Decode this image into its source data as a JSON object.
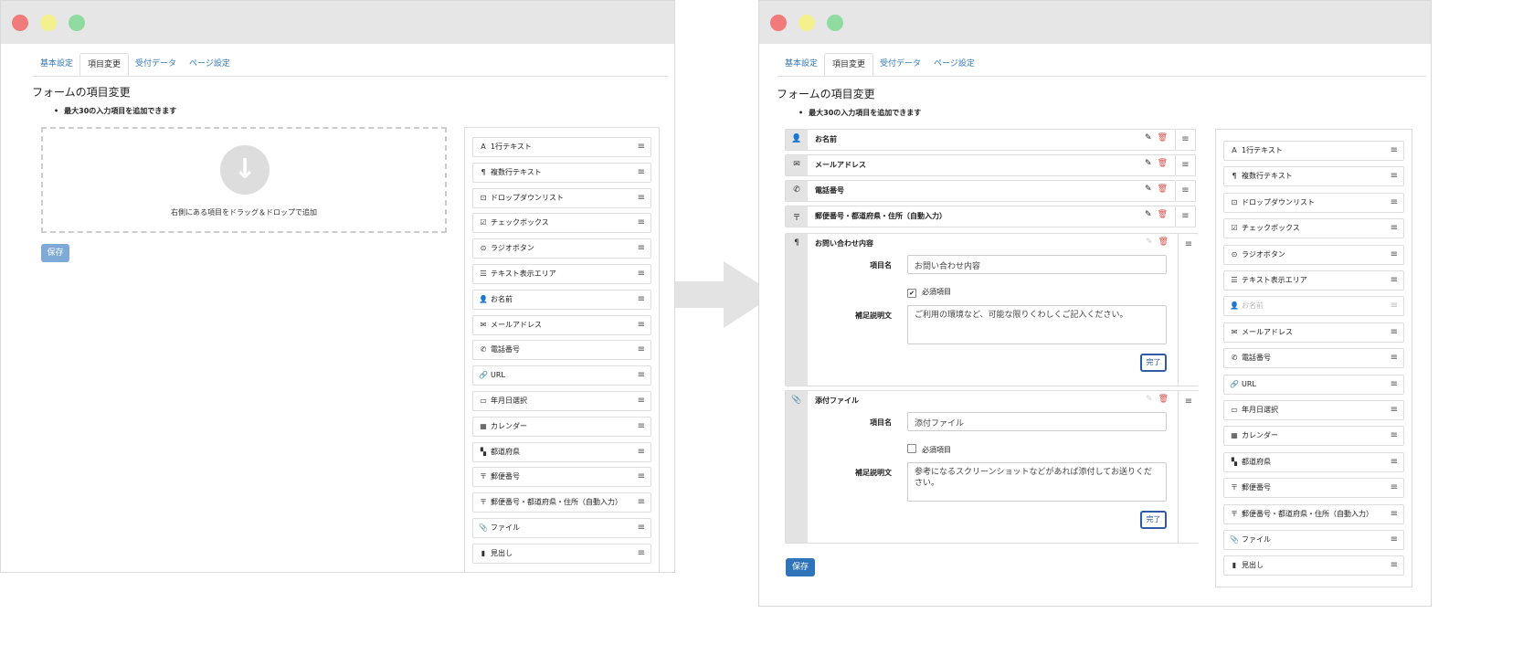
{
  "colors": {
    "tab_link": "#337ab7",
    "save_disabled": "#7fa9d6",
    "save_active": "#2f74b9",
    "delete": "#d9534f",
    "done_border": "#2e5aa8",
    "arrow": "#e3e3e3",
    "dot_red": "#f07b7a",
    "dot_yellow": "#f4f08d",
    "dot_green": "#8fdba0"
  },
  "tabs": [
    "基本設定",
    "項目変更",
    "受付データ",
    "ページ設定"
  ],
  "heading": "フォームの項目変更",
  "note": "最大30の入力項目を追加できます",
  "save_label": "保存",
  "drop_text": "右側にある項目をドラッグ＆ドロップで追加",
  "palette": [
    {
      "icon": "A",
      "label": "1行テキスト",
      "name": "single-line-text"
    },
    {
      "icon": "¶",
      "label": "複数行テキスト",
      "name": "multi-line-text"
    },
    {
      "icon": "⊡",
      "label": "ドロップダウンリスト",
      "name": "dropdown-list"
    },
    {
      "icon": "☑",
      "label": "チェックボックス",
      "name": "checkbox"
    },
    {
      "icon": "⊙",
      "label": "ラジオボタン",
      "name": "radio-button"
    },
    {
      "icon": "☰",
      "label": "テキスト表示エリア",
      "name": "text-display-area"
    },
    {
      "icon": "👤",
      "label": "お名前",
      "name": "name"
    },
    {
      "icon": "✉",
      "label": "メールアドレス",
      "name": "email"
    },
    {
      "icon": "✆",
      "label": "電話番号",
      "name": "phone"
    },
    {
      "icon": "🔗",
      "label": "URL",
      "name": "url"
    },
    {
      "icon": "▭",
      "label": "年月日選択",
      "name": "date-select"
    },
    {
      "icon": "▦",
      "label": "カレンダー",
      "name": "calendar"
    },
    {
      "icon": "▚",
      "label": "都道府県",
      "name": "prefecture"
    },
    {
      "icon": "〒",
      "label": "郵便番号",
      "name": "postal-code"
    },
    {
      "icon": "〒",
      "label": "郵便番号・都道府県・住所（自動入力）",
      "name": "postal-address-auto"
    },
    {
      "icon": "📎",
      "label": "ファイル",
      "name": "file"
    },
    {
      "icon": "▮",
      "label": "見出し",
      "name": "heading"
    }
  ],
  "form_items": [
    {
      "icon": "👤",
      "title": "お名前",
      "name": "name"
    },
    {
      "icon": "✉",
      "title": "メールアドレス",
      "name": "email"
    },
    {
      "icon": "✆",
      "title": "電話番号",
      "name": "phone"
    },
    {
      "icon": "〒",
      "title": "郵便番号・都道府県・住所（自動入力）",
      "name": "postal-address-auto"
    }
  ],
  "expanded_items": [
    {
      "icon": "¶",
      "title": "お問い合わせ内容",
      "name": "inquiry",
      "field_label": "項目名",
      "field_value": "お問い合わせ内容",
      "required_label": "必須項目",
      "required_checked": true,
      "desc_label": "補足説明文",
      "desc_value": "ご利用の環境など、可能な限りくわしくご記入ください。",
      "done_label": "完了"
    },
    {
      "icon": "📎",
      "title": "添付ファイル",
      "name": "attachment",
      "field_label": "項目名",
      "field_value": "添付ファイル",
      "required_label": "必須項目",
      "required_checked": false,
      "desc_label": "補足説明文",
      "desc_value": "参考になるスクリーンショットなどがあれば添付してお送りください。",
      "done_label": "完了"
    }
  ],
  "icons": {
    "pencil": "✎",
    "trash": "🗑",
    "handle": "≡",
    "arrow_down": "⬇"
  }
}
